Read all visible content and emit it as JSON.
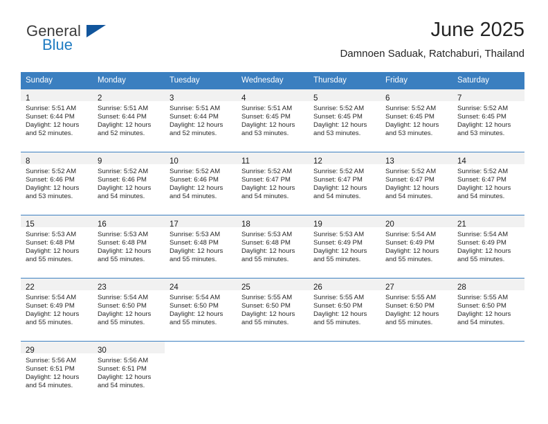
{
  "brand": {
    "name_part1": "General",
    "name_part2": "Blue",
    "triangle_icon": "triangle-icon",
    "color_dark": "#3b3b3b",
    "color_blue": "#1f7bc1",
    "color_triangle": "#11559c"
  },
  "header": {
    "title": "June 2025",
    "subtitle": "Damnoen Saduak, Ratchaburi, Thailand"
  },
  "theme": {
    "header_bg": "#3b7fc0",
    "header_text": "#ffffff",
    "daynum_bg": "#f1f1f1",
    "row_border": "#3b7fc0",
    "body_text": "#272727"
  },
  "weekdays": [
    "Sunday",
    "Monday",
    "Tuesday",
    "Wednesday",
    "Thursday",
    "Friday",
    "Saturday"
  ],
  "weeks": [
    [
      {
        "day": "1",
        "sunrise": "Sunrise: 5:51 AM",
        "sunset": "Sunset: 6:44 PM",
        "daylight_line1": "Daylight: 12 hours",
        "daylight_line2": "and 52 minutes."
      },
      {
        "day": "2",
        "sunrise": "Sunrise: 5:51 AM",
        "sunset": "Sunset: 6:44 PM",
        "daylight_line1": "Daylight: 12 hours",
        "daylight_line2": "and 52 minutes."
      },
      {
        "day": "3",
        "sunrise": "Sunrise: 5:51 AM",
        "sunset": "Sunset: 6:44 PM",
        "daylight_line1": "Daylight: 12 hours",
        "daylight_line2": "and 52 minutes."
      },
      {
        "day": "4",
        "sunrise": "Sunrise: 5:51 AM",
        "sunset": "Sunset: 6:45 PM",
        "daylight_line1": "Daylight: 12 hours",
        "daylight_line2": "and 53 minutes."
      },
      {
        "day": "5",
        "sunrise": "Sunrise: 5:52 AM",
        "sunset": "Sunset: 6:45 PM",
        "daylight_line1": "Daylight: 12 hours",
        "daylight_line2": "and 53 minutes."
      },
      {
        "day": "6",
        "sunrise": "Sunrise: 5:52 AM",
        "sunset": "Sunset: 6:45 PM",
        "daylight_line1": "Daylight: 12 hours",
        "daylight_line2": "and 53 minutes."
      },
      {
        "day": "7",
        "sunrise": "Sunrise: 5:52 AM",
        "sunset": "Sunset: 6:45 PM",
        "daylight_line1": "Daylight: 12 hours",
        "daylight_line2": "and 53 minutes."
      }
    ],
    [
      {
        "day": "8",
        "sunrise": "Sunrise: 5:52 AM",
        "sunset": "Sunset: 6:46 PM",
        "daylight_line1": "Daylight: 12 hours",
        "daylight_line2": "and 53 minutes."
      },
      {
        "day": "9",
        "sunrise": "Sunrise: 5:52 AM",
        "sunset": "Sunset: 6:46 PM",
        "daylight_line1": "Daylight: 12 hours",
        "daylight_line2": "and 54 minutes."
      },
      {
        "day": "10",
        "sunrise": "Sunrise: 5:52 AM",
        "sunset": "Sunset: 6:46 PM",
        "daylight_line1": "Daylight: 12 hours",
        "daylight_line2": "and 54 minutes."
      },
      {
        "day": "11",
        "sunrise": "Sunrise: 5:52 AM",
        "sunset": "Sunset: 6:47 PM",
        "daylight_line1": "Daylight: 12 hours",
        "daylight_line2": "and 54 minutes."
      },
      {
        "day": "12",
        "sunrise": "Sunrise: 5:52 AM",
        "sunset": "Sunset: 6:47 PM",
        "daylight_line1": "Daylight: 12 hours",
        "daylight_line2": "and 54 minutes."
      },
      {
        "day": "13",
        "sunrise": "Sunrise: 5:52 AM",
        "sunset": "Sunset: 6:47 PM",
        "daylight_line1": "Daylight: 12 hours",
        "daylight_line2": "and 54 minutes."
      },
      {
        "day": "14",
        "sunrise": "Sunrise: 5:52 AM",
        "sunset": "Sunset: 6:47 PM",
        "daylight_line1": "Daylight: 12 hours",
        "daylight_line2": "and 54 minutes."
      }
    ],
    [
      {
        "day": "15",
        "sunrise": "Sunrise: 5:53 AM",
        "sunset": "Sunset: 6:48 PM",
        "daylight_line1": "Daylight: 12 hours",
        "daylight_line2": "and 55 minutes."
      },
      {
        "day": "16",
        "sunrise": "Sunrise: 5:53 AM",
        "sunset": "Sunset: 6:48 PM",
        "daylight_line1": "Daylight: 12 hours",
        "daylight_line2": "and 55 minutes."
      },
      {
        "day": "17",
        "sunrise": "Sunrise: 5:53 AM",
        "sunset": "Sunset: 6:48 PM",
        "daylight_line1": "Daylight: 12 hours",
        "daylight_line2": "and 55 minutes."
      },
      {
        "day": "18",
        "sunrise": "Sunrise: 5:53 AM",
        "sunset": "Sunset: 6:48 PM",
        "daylight_line1": "Daylight: 12 hours",
        "daylight_line2": "and 55 minutes."
      },
      {
        "day": "19",
        "sunrise": "Sunrise: 5:53 AM",
        "sunset": "Sunset: 6:49 PM",
        "daylight_line1": "Daylight: 12 hours",
        "daylight_line2": "and 55 minutes."
      },
      {
        "day": "20",
        "sunrise": "Sunrise: 5:54 AM",
        "sunset": "Sunset: 6:49 PM",
        "daylight_line1": "Daylight: 12 hours",
        "daylight_line2": "and 55 minutes."
      },
      {
        "day": "21",
        "sunrise": "Sunrise: 5:54 AM",
        "sunset": "Sunset: 6:49 PM",
        "daylight_line1": "Daylight: 12 hours",
        "daylight_line2": "and 55 minutes."
      }
    ],
    [
      {
        "day": "22",
        "sunrise": "Sunrise: 5:54 AM",
        "sunset": "Sunset: 6:49 PM",
        "daylight_line1": "Daylight: 12 hours",
        "daylight_line2": "and 55 minutes."
      },
      {
        "day": "23",
        "sunrise": "Sunrise: 5:54 AM",
        "sunset": "Sunset: 6:50 PM",
        "daylight_line1": "Daylight: 12 hours",
        "daylight_line2": "and 55 minutes."
      },
      {
        "day": "24",
        "sunrise": "Sunrise: 5:54 AM",
        "sunset": "Sunset: 6:50 PM",
        "daylight_line1": "Daylight: 12 hours",
        "daylight_line2": "and 55 minutes."
      },
      {
        "day": "25",
        "sunrise": "Sunrise: 5:55 AM",
        "sunset": "Sunset: 6:50 PM",
        "daylight_line1": "Daylight: 12 hours",
        "daylight_line2": "and 55 minutes."
      },
      {
        "day": "26",
        "sunrise": "Sunrise: 5:55 AM",
        "sunset": "Sunset: 6:50 PM",
        "daylight_line1": "Daylight: 12 hours",
        "daylight_line2": "and 55 minutes."
      },
      {
        "day": "27",
        "sunrise": "Sunrise: 5:55 AM",
        "sunset": "Sunset: 6:50 PM",
        "daylight_line1": "Daylight: 12 hours",
        "daylight_line2": "and 55 minutes."
      },
      {
        "day": "28",
        "sunrise": "Sunrise: 5:55 AM",
        "sunset": "Sunset: 6:50 PM",
        "daylight_line1": "Daylight: 12 hours",
        "daylight_line2": "and 54 minutes."
      }
    ],
    [
      {
        "day": "29",
        "sunrise": "Sunrise: 5:56 AM",
        "sunset": "Sunset: 6:51 PM",
        "daylight_line1": "Daylight: 12 hours",
        "daylight_line2": "and 54 minutes."
      },
      {
        "day": "30",
        "sunrise": "Sunrise: 5:56 AM",
        "sunset": "Sunset: 6:51 PM",
        "daylight_line1": "Daylight: 12 hours",
        "daylight_line2": "and 54 minutes."
      },
      null,
      null,
      null,
      null,
      null
    ]
  ]
}
